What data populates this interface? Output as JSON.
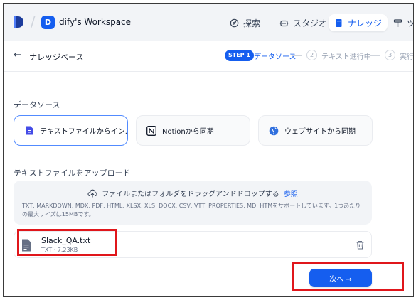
{
  "workspace": {
    "initial": "D",
    "name": "dify's Workspace"
  },
  "nav": {
    "explore": "探索",
    "studio": "スタジオ",
    "knowledge": "ナレッジ",
    "tools": "ツ"
  },
  "subheader": {
    "back_title": "ナレッジベース",
    "steps": [
      {
        "badge": "STEP 1",
        "label": "データソース"
      },
      {
        "num": "2",
        "label": "テキスト進行中"
      },
      {
        "num": "3",
        "label": "実行"
      }
    ]
  },
  "datasource": {
    "title": "データソース",
    "options": [
      {
        "label": "テキストファイルからイン...",
        "selected": true
      },
      {
        "label": "Notionから同期",
        "selected": false
      },
      {
        "label": "ウェブサイトから同期",
        "selected": false
      }
    ]
  },
  "upload": {
    "title": "テキストファイルをアップロード",
    "drop_text": "ファイルまたはフォルダをドラッグアンドドロップする",
    "browse_link": "参照",
    "description": "TXT, MARKDOWN, MDX, PDF, HTML, XLSX, XLS, DOCX, CSV, VTT, PROPERTIES, MD, HTMをサポートしています。1つあたりの最大サイズは15MBです。"
  },
  "file": {
    "name": "Slack_QA.txt",
    "meta": "TXT · 7.23KB"
  },
  "next_button": "次へ →",
  "colors": {
    "accent": "#155eef",
    "highlight": "#e0161b"
  }
}
